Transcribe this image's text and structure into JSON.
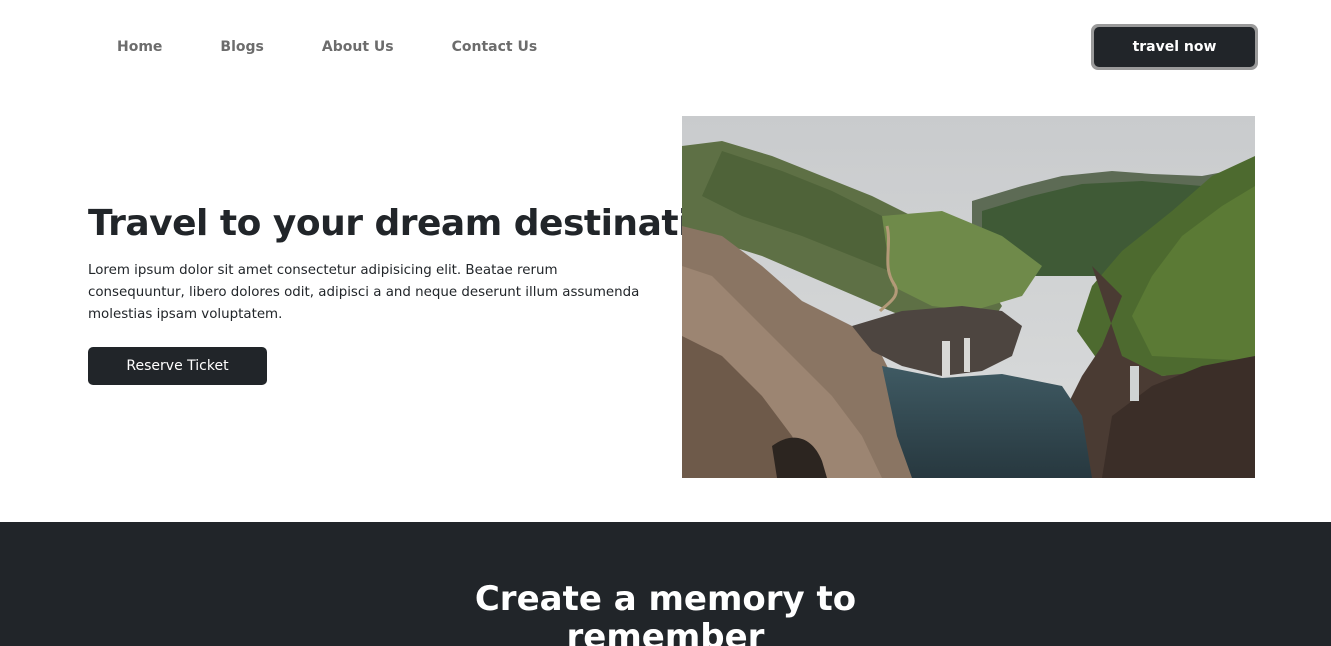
{
  "nav": {
    "links": [
      {
        "label": "Home"
      },
      {
        "label": "Blogs"
      },
      {
        "label": "About Us"
      },
      {
        "label": "Contact Us"
      }
    ],
    "cta_label": "travel now"
  },
  "hero": {
    "title": "Travel to your dream destination",
    "text": "Lorem ipsum dolor sit amet consectetur adipisicing elit. Beatae rerum consequuntur, libero dolores odit, adipisci a and neque deserunt illum assumenda molestias ipsam voluptatem.",
    "button_label": "Reserve Ticket",
    "image_icon": "coastal-canyon-photo"
  },
  "section": {
    "title_line1": "Create a memory to",
    "title_line2": "remember"
  },
  "colors": {
    "dark": "#212529",
    "nav_text": "#6c6c6c",
    "cta_border": "#9a9a9a"
  }
}
